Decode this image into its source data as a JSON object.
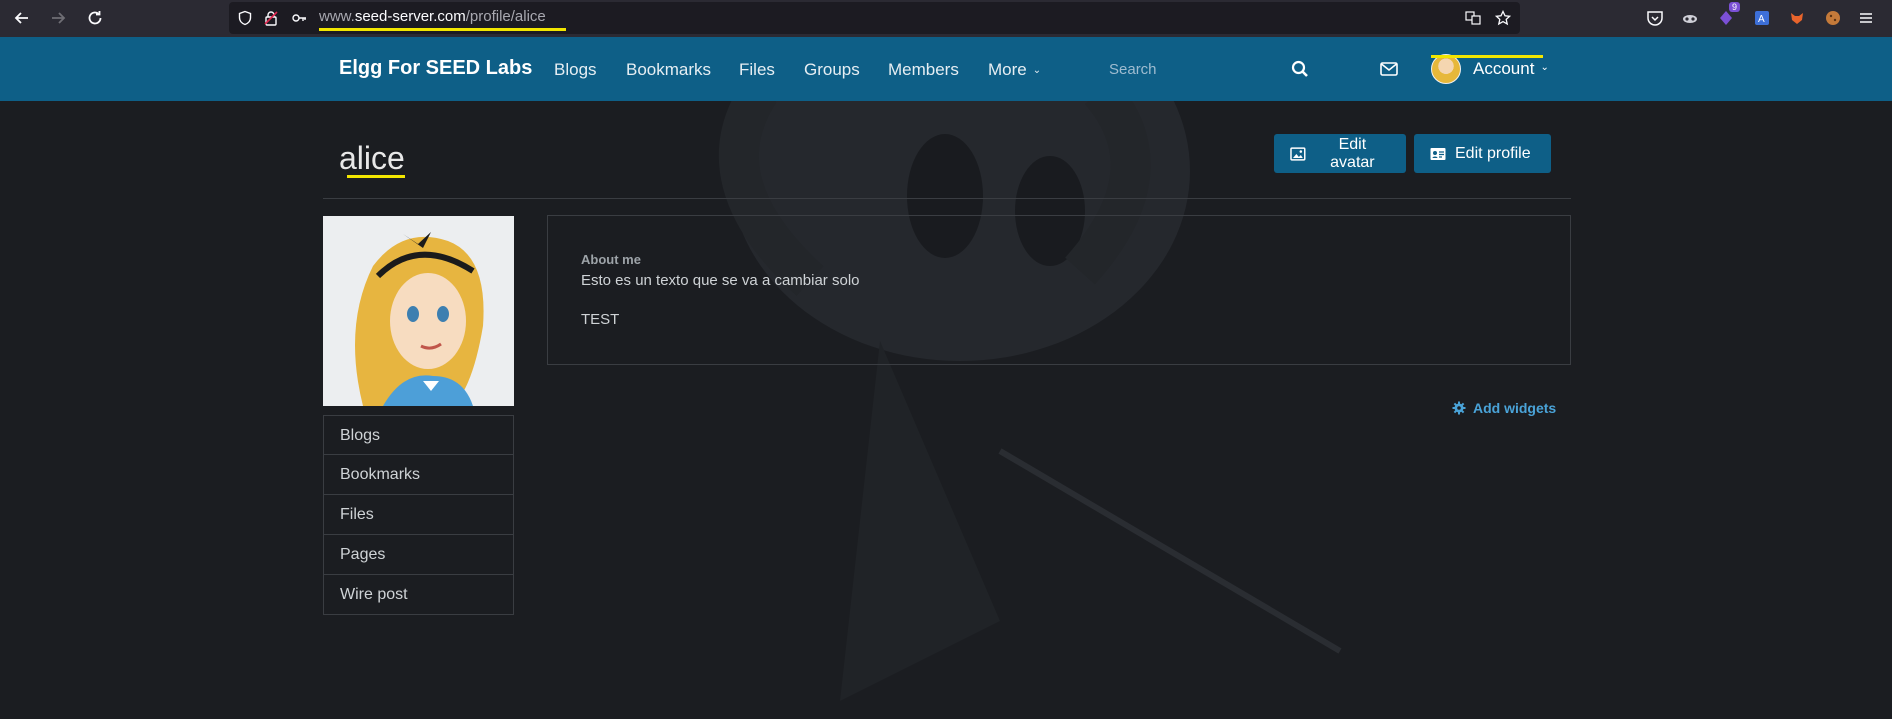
{
  "browser": {
    "url_host": "www.seed-server.com",
    "url_path": "/profile/alice",
    "extension_badge": "9"
  },
  "header": {
    "brand": "Elgg For SEED Labs",
    "nav": [
      "Blogs",
      "Bookmarks",
      "Files",
      "Groups",
      "Members",
      "More"
    ],
    "search_placeholder": "Search",
    "account_label": "Account"
  },
  "profile": {
    "name": "alice",
    "edit_avatar": "Edit avatar",
    "edit_profile": "Edit profile",
    "about_label": "About me",
    "about_text": "Esto es un texto que se va a cambiar solo",
    "about_text2": "TEST",
    "add_widgets": "Add widgets"
  },
  "sidebar": {
    "items": [
      "Blogs",
      "Bookmarks",
      "Files",
      "Pages",
      "Wire post"
    ]
  },
  "colors": {
    "header_bg": "#0e5f87",
    "page_bg": "#1b1d21",
    "highlight": "#f2e600",
    "link": "#4aa3d8"
  }
}
